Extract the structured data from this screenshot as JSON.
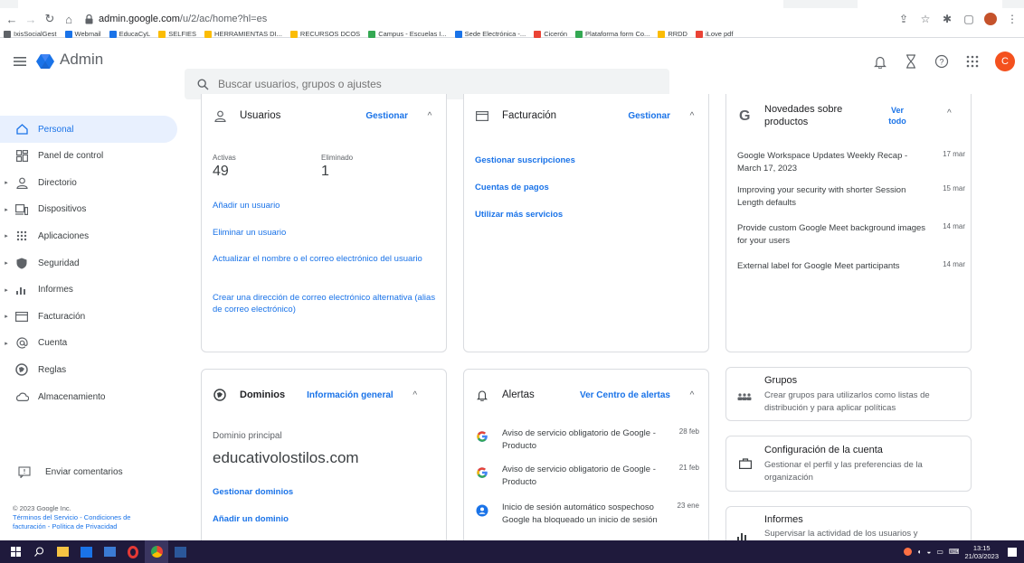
{
  "browser": {
    "url_host": "admin.google.com",
    "url_path": "/u/2/ac/home?hl=es"
  },
  "bookmarks": [
    {
      "label": "IxisSocialGest",
      "color": "#5f6368"
    },
    {
      "label": "Webmail",
      "color": "#1a73e8"
    },
    {
      "label": "EducaCyL",
      "color": "#1a73e8"
    },
    {
      "label": "SELFIES",
      "color": "#fbbc04"
    },
    {
      "label": "HERRAMIENTAS DI...",
      "color": "#fbbc04"
    },
    {
      "label": "RECURSOS DCOS",
      "color": "#fbbc04"
    },
    {
      "label": "Campus - Escuelas I...",
      "color": "#34a853"
    },
    {
      "label": "Sede Electrónica -...",
      "color": "#1a73e8"
    },
    {
      "label": "Cicerón",
      "color": "#ea4335"
    },
    {
      "label": "Plataforma form Co...",
      "color": "#34a853"
    },
    {
      "label": "RRDD",
      "color": "#fbbc04"
    },
    {
      "label": "iLove pdf",
      "color": "#ea4335"
    }
  ],
  "header": {
    "title": "Admin",
    "search_placeholder": "Buscar usuarios, grupos o ajustes",
    "avatar_letter": "C"
  },
  "sidebar": {
    "items": [
      {
        "label": "Personal",
        "icon": "home-icon",
        "active": true,
        "expandable": false
      },
      {
        "label": "Panel de control",
        "icon": "dashboard-icon",
        "active": false,
        "expandable": false
      },
      {
        "label": "Directorio",
        "icon": "person-icon",
        "active": false,
        "expandable": true
      },
      {
        "label": "Dispositivos",
        "icon": "devices-icon",
        "active": false,
        "expandable": true
      },
      {
        "label": "Aplicaciones",
        "icon": "apps-icon",
        "active": false,
        "expandable": true
      },
      {
        "label": "Seguridad",
        "icon": "shield-icon",
        "active": false,
        "expandable": true
      },
      {
        "label": "Informes",
        "icon": "bar-chart-icon",
        "active": false,
        "expandable": true
      },
      {
        "label": "Facturación",
        "icon": "billing-icon",
        "active": false,
        "expandable": true
      },
      {
        "label": "Cuenta",
        "icon": "at-icon",
        "active": false,
        "expandable": true
      },
      {
        "label": "Reglas",
        "icon": "rules-icon",
        "active": false,
        "expandable": false
      },
      {
        "label": "Almacenamiento",
        "icon": "cloud-icon",
        "active": false,
        "expandable": false
      }
    ],
    "feedback_label": "Enviar comentarios",
    "copyright": "© 2023 Google Inc.",
    "footer_links_line1": "Términos del Servicio - Condiciones de",
    "footer_links_line2": "facturación - Política de Privacidad"
  },
  "users_card": {
    "title": "Usuarios",
    "action": "Gestionar",
    "active_label": "Activas",
    "active_count": "49",
    "deleted_label": "Eliminado",
    "deleted_count": "1",
    "links": [
      "Añadir un usuario",
      "Eliminar un usuario",
      "Actualizar el nombre o el correo electrónico del usuario",
      "Crear una dirección de correo electrónico alternativa (alias de correo electrónico)"
    ]
  },
  "billing_card": {
    "title": "Facturación",
    "action": "Gestionar",
    "links": [
      "Gestionar suscripciones",
      "Cuentas de pagos",
      "Utilizar más servicios"
    ]
  },
  "news_card": {
    "title": "Novedades sobre productos",
    "action": "Ver todo",
    "items": [
      {
        "text": "Google Workspace Updates Weekly Recap - March 17, 2023",
        "date": "17 mar"
      },
      {
        "text": "Improving your security with shorter Session Length defaults",
        "date": "15 mar"
      },
      {
        "text": "Provide custom Google Meet background images for your users",
        "date": "14 mar"
      },
      {
        "text": "External label for Google Meet participants",
        "date": "14 mar"
      }
    ]
  },
  "domains_card": {
    "title": "Dominios",
    "action": "Información general",
    "primary_label": "Dominio principal",
    "primary_domain": "educativolostilos.com",
    "links": [
      "Gestionar dominios",
      "Añadir un dominio"
    ]
  },
  "alerts_card": {
    "title": "Alertas",
    "action": "Ver Centro de alertas",
    "items": [
      {
        "text": "Aviso de servicio obligatorio de Google - Producto",
        "date": "28 feb",
        "icon": "google-g-icon"
      },
      {
        "text": "Aviso de servicio obligatorio de Google - Producto",
        "date": "21 feb",
        "icon": "google-g-icon"
      },
      {
        "text": "Inicio de sesión automático sospechoso",
        "sub": "Google ha bloqueado un inicio de sesión",
        "date": "23 ene",
        "icon": "account-alert-icon"
      }
    ]
  },
  "groups_card": {
    "title": "Grupos",
    "desc": "Crear grupos para utilizarlos como listas de distribución y para aplicar políticas"
  },
  "account_card": {
    "title": "Configuración de la cuenta",
    "desc": "Gestionar el perfil y las preferencias de la organización"
  },
  "reports_card": {
    "title": "Informes",
    "desc": "Supervisar la actividad de los usuarios y"
  },
  "taskbar": {
    "time": "13:15",
    "date": "21/03/2023"
  }
}
